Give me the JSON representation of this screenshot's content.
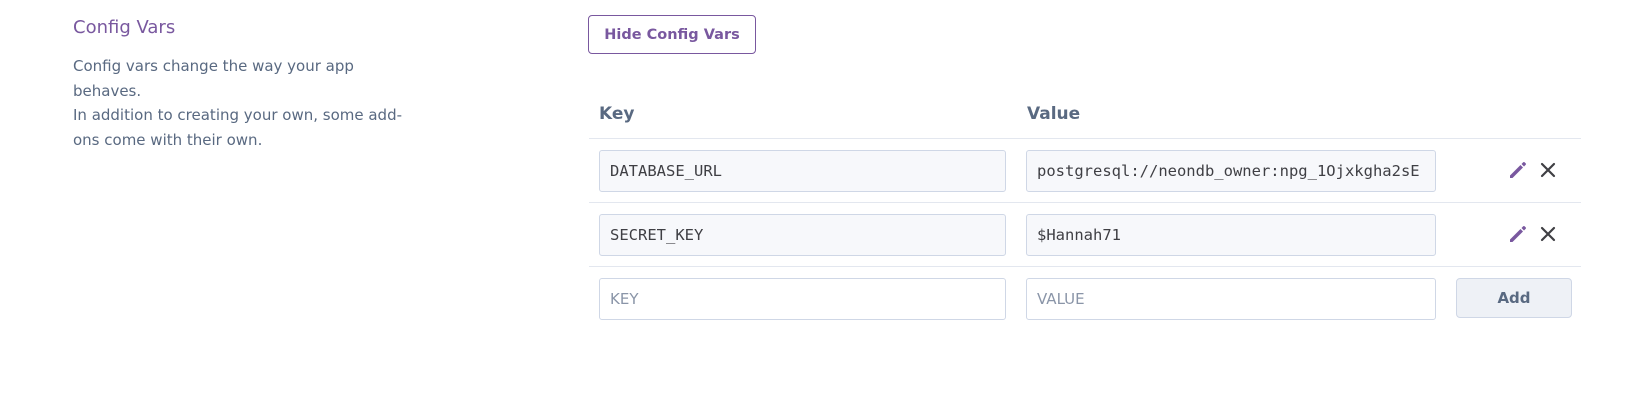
{
  "section": {
    "title": "Config Vars",
    "description_lines": [
      "Config vars change the way your app behaves.",
      "In addition to creating your own, some add-",
      "ons come with their own."
    ]
  },
  "hide_button": {
    "label": "Hide Config Vars"
  },
  "table": {
    "headers": {
      "key": "Key",
      "value": "Value"
    },
    "rows": [
      {
        "key": "DATABASE_URL",
        "value": "postgresql://neondb_owner:npg_1Ojxkgha2sE",
        "actions": [
          "pencil-icon",
          "close-icon"
        ]
      },
      {
        "key": "SECRET_KEY",
        "value": "$Hannah71",
        "actions": [
          "pencil-icon",
          "close-icon"
        ]
      }
    ],
    "new_row": {
      "key_placeholder": "KEY",
      "value_placeholder": "VALUE",
      "add_label": "Add"
    }
  },
  "colors": {
    "accent": "#79589f",
    "text_muted": "#596981",
    "border": "#cfd7e6",
    "row_divider": "#e3e7ef"
  }
}
